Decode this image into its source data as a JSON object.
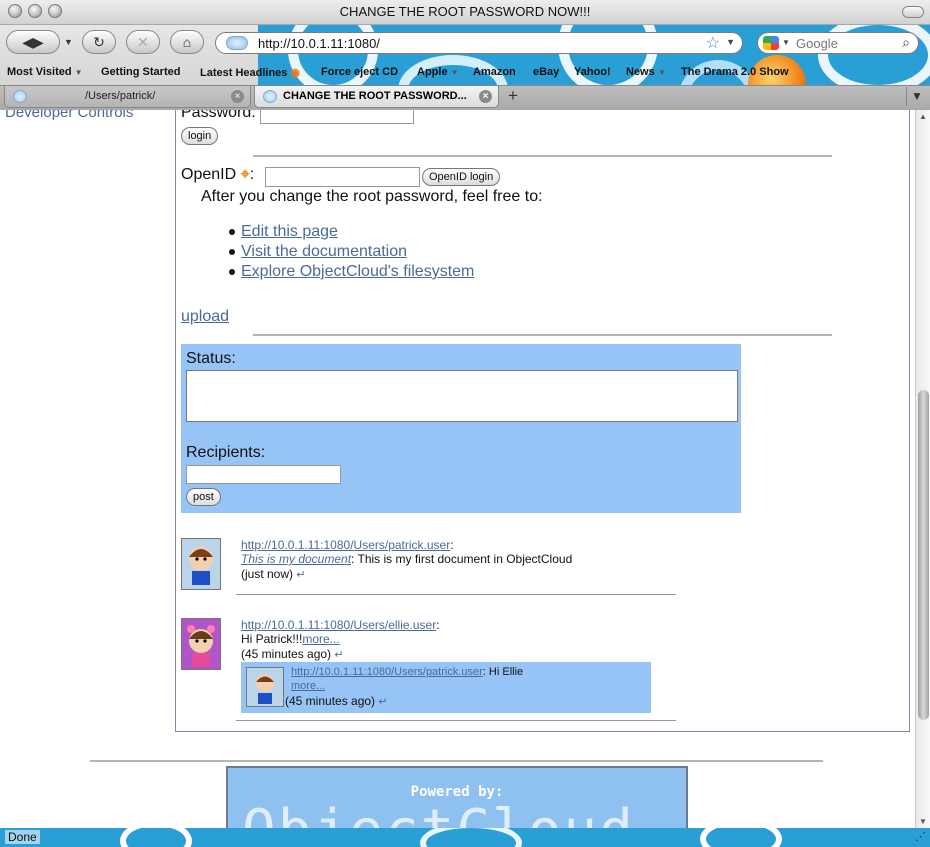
{
  "window": {
    "title": "CHANGE THE ROOT PASSWORD NOW!!!"
  },
  "toolbar": {
    "url": "http://10.0.1.11:1080/",
    "search_placeholder": "Google"
  },
  "bookmarks": [
    "Most Visited",
    "Getting Started",
    "Latest Headlines",
    "Force eject CD",
    "Apple",
    "Amazon",
    "eBay",
    "Yahoo!",
    "News",
    "The Drama 2.0 Show"
  ],
  "tabs": [
    {
      "label": "/Users/patrick/"
    },
    {
      "label": "CHANGE THE ROOT PASSWORD..."
    }
  ],
  "sidebar": {
    "label": "Developer Controls"
  },
  "login": {
    "password_label": "Password:",
    "login_button": "login",
    "openid_label": "OpenID",
    "openid_colon": ":",
    "openid_button": "OpenID login"
  },
  "content": {
    "intro": "After you change the root password, feel free to:",
    "links": [
      "Edit this page",
      "Visit the documentation",
      "Explore ObjectCloud's filesystem"
    ],
    "upload": "upload"
  },
  "status_form": {
    "status_label": "Status:",
    "recipients_label": "Recipients:",
    "post_button": "post"
  },
  "feed": [
    {
      "user_url": "http://10.0.1.11:1080/Users/patrick.user",
      "doc_title": "This is my document",
      "text": ": This is my first document in ObjectCloud",
      "time": "(just now)"
    },
    {
      "user_url": "http://10.0.1.11:1080/Users/ellie.user",
      "text": "Hi Patrick!!!",
      "more": "more...",
      "time": "(45 minutes ago)",
      "reply": {
        "user_url": "http://10.0.1.11:1080/Users/patrick.user",
        "text": ": Hi Ellie",
        "more": "more...",
        "time": "(45 minutes ago)"
      }
    }
  ],
  "footer": {
    "powered_by": "Powered by:",
    "logo_text": "ObjectCloud"
  },
  "statusbar": {
    "text": "Done"
  },
  "colors": {
    "accent": "#2a9fd6",
    "status_panel": "#97c4f7",
    "link": "#4a6a98"
  }
}
